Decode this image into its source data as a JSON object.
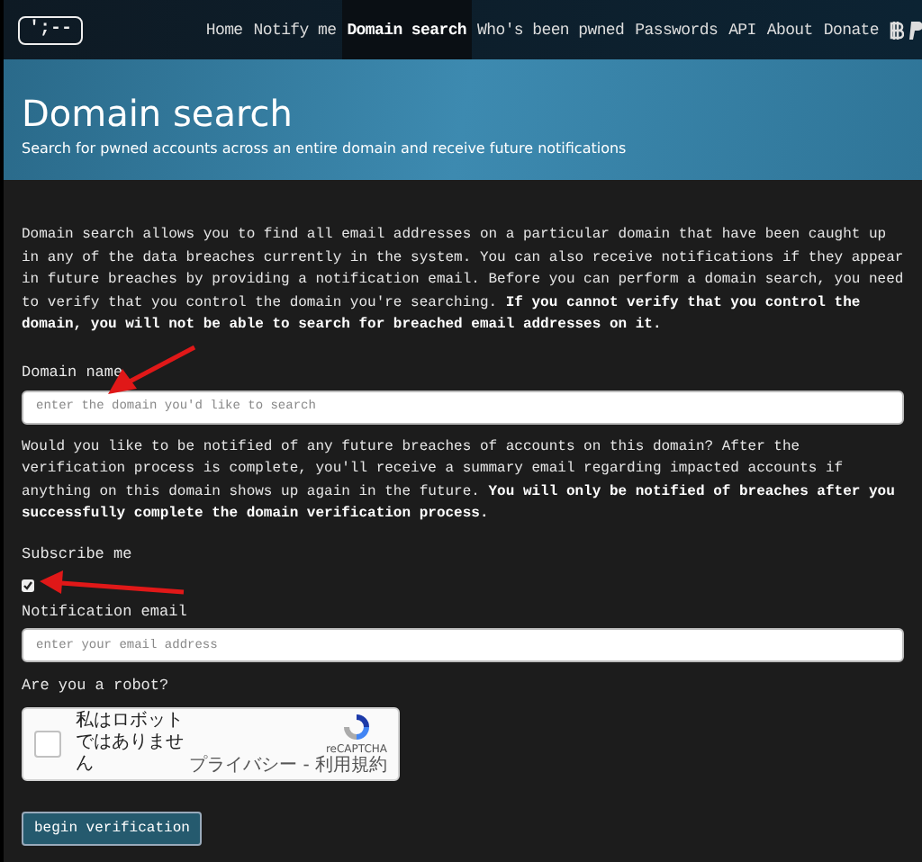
{
  "nav": {
    "logo": "';--",
    "items": [
      {
        "label": "Home",
        "selected": false
      },
      {
        "label": "Notify me",
        "selected": false
      },
      {
        "label": "Domain search",
        "selected": true
      },
      {
        "label": "Who's been pwned",
        "selected": false
      },
      {
        "label": "Passwords",
        "selected": false
      },
      {
        "label": "API",
        "selected": false
      },
      {
        "label": "About",
        "selected": false
      },
      {
        "label": "Donate",
        "selected": false
      }
    ]
  },
  "hero": {
    "title": "Domain search",
    "subtitle": "Search for pwned accounts across an entire domain and receive future notifications"
  },
  "intro": "Domain search allows you to find all email addresses on a particular domain that have been caught up in any of the data breaches currently in the system. You can also receive notifications if they appear in future breaches by providing a notification email. Before you can perform a domain search, you need to verify that you control the domain you're searching. **If you cannot verify that you control the domain, you will not be able to search for breached email addresses on it.**",
  "domain_field": {
    "label": "Domain name",
    "placeholder": "enter the domain you'd like to search"
  },
  "notify_text": "Would you like to be notified of any future breaches of accounts on this domain? After the verification process is complete, you'll receive a summary email regarding impacted accounts if anything on this domain shows up again in the future. **You will only be notified of breaches after you successfully complete the domain verification process.**",
  "subscribe": {
    "label": "Subscribe me",
    "checked": true
  },
  "email_field": {
    "label": "Notification email",
    "placeholder": "enter your email address"
  },
  "captcha": {
    "label": "Are you a robot?",
    "checkbox_text": "私はロボットではありません",
    "checked": false,
    "brand": "reCAPTCHA",
    "links": "プライバシー - 利用規約"
  },
  "submit": "begin verification"
}
